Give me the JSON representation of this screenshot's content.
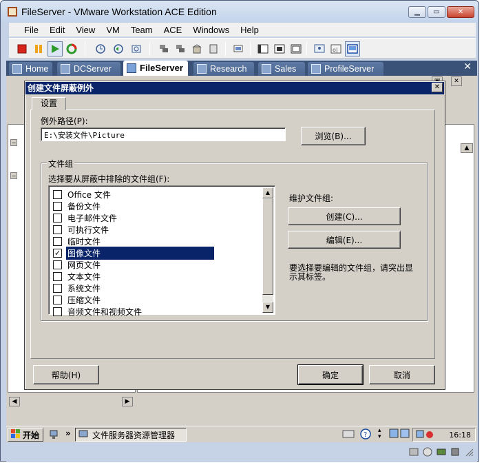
{
  "window": {
    "title": "FileServer - VMware Workstation ACE Edition"
  },
  "menu": [
    "File",
    "Edit",
    "View",
    "VM",
    "Team",
    "ACE",
    "Windows",
    "Help"
  ],
  "tabs": [
    {
      "label": "Home",
      "active": false
    },
    {
      "label": "DCServer",
      "active": false
    },
    {
      "label": "FileServer",
      "active": true
    },
    {
      "label": "Research",
      "active": false
    },
    {
      "label": "Sales",
      "active": false
    },
    {
      "label": "ProfileServer",
      "active": false
    }
  ],
  "dialog": {
    "title": "创建文件屏蔽例外",
    "close_glyph": "✕",
    "tab": "设置",
    "path_label": "例外路径(P):",
    "path_value": "E:\\安装文件\\Picture",
    "browse_button": "浏览(B)...",
    "group_title": "文件组",
    "list_label": "选择要从屏蔽中排除的文件组(F):",
    "file_groups": [
      {
        "label": "Office 文件",
        "checked": false,
        "selected": false
      },
      {
        "label": "备份文件",
        "checked": false,
        "selected": false
      },
      {
        "label": "电子邮件文件",
        "checked": false,
        "selected": false
      },
      {
        "label": "可执行文件",
        "checked": false,
        "selected": false
      },
      {
        "label": "临时文件",
        "checked": false,
        "selected": false
      },
      {
        "label": "图像文件",
        "checked": true,
        "selected": true
      },
      {
        "label": "网页文件",
        "checked": false,
        "selected": false
      },
      {
        "label": "文本文件",
        "checked": false,
        "selected": false
      },
      {
        "label": "系统文件",
        "checked": false,
        "selected": false
      },
      {
        "label": "压缩文件",
        "checked": false,
        "selected": false
      },
      {
        "label": "音频文件和视频文件",
        "checked": false,
        "selected": false
      }
    ],
    "maintain_label": "维护文件组:",
    "create_button": "创建(C)...",
    "edit_button": "编辑(E)...",
    "hint_text": "要选择要编辑的文件组，请突出显示其标签。",
    "help_button": "帮助(H)",
    "ok_button": "确定",
    "cancel_button": "取消"
  },
  "taskbar": {
    "start": "开始",
    "task": "文件服务器资源管理器",
    "clock": "16:18"
  },
  "colors": {
    "dialog_title_bg": "#0a246a",
    "selection_bg": "#0a246a",
    "chrome_bg": "#d4d0c8",
    "vm_tabbar": "#3a5178"
  }
}
